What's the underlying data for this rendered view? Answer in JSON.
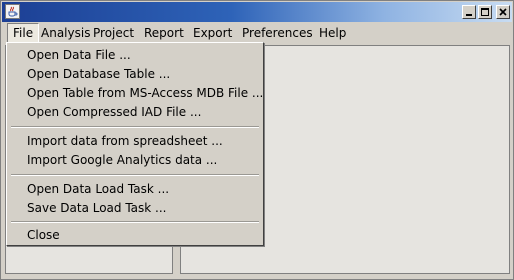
{
  "window": {
    "icon": "java-cup-icon",
    "controls": [
      "minimize-icon",
      "maximize-icon",
      "close-icon"
    ]
  },
  "menubar": {
    "items": [
      {
        "label": "File",
        "active": true
      },
      {
        "label": "Analysis"
      },
      {
        "label": "Project"
      },
      {
        "label": "Report"
      },
      {
        "label": "Export"
      },
      {
        "label": "Preferences"
      },
      {
        "label": "Help"
      }
    ]
  },
  "file_menu": {
    "group_open": [
      "Open Data File ...",
      "Open Database Table ...",
      "Open Table from MS-Access MDB File ...",
      "Open Compressed IAD File ..."
    ],
    "group_import": [
      "Import data from spreadsheet ...",
      "Import Google Analytics data ..."
    ],
    "group_task": [
      "Open Data Load Task ...",
      "Save Data Load Task ..."
    ],
    "group_close": [
      "Close"
    ]
  },
  "colors": {
    "titlebar_start": "#1c3f94",
    "titlebar_end": "#c8dcf2",
    "menu_bg": "#d4d0c8",
    "panel_bg": "#e6e4e0"
  }
}
